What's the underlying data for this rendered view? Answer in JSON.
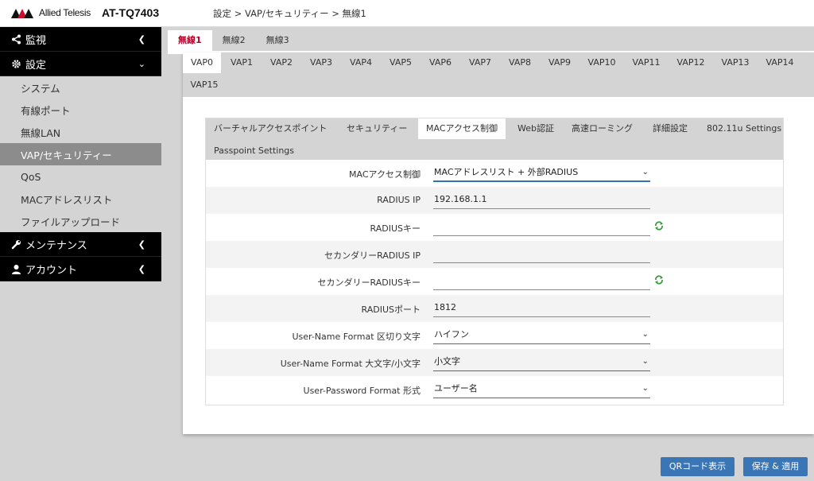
{
  "header": {
    "logo_text": "Allied Telesis",
    "model": "AT-TQ7403",
    "breadcrumb": "設定 > VAP/セキュリティー > 無線1"
  },
  "sidebar": {
    "monitor": "監視",
    "settings": "設定",
    "items": [
      "システム",
      "有線ポート",
      "無線LAN",
      "VAP/セキュリティー",
      "QoS",
      "MACアドレスリスト",
      "ファイルアップロード"
    ],
    "maintenance": "メンテナンス",
    "account": "アカウント"
  },
  "radio_tabs": [
    "無線1",
    "無線2",
    "無線3"
  ],
  "vap_tabs": [
    "VAP0",
    "VAP1",
    "VAP2",
    "VAP3",
    "VAP4",
    "VAP5",
    "VAP6",
    "VAP7",
    "VAP8",
    "VAP9",
    "VAP10",
    "VAP11",
    "VAP12",
    "VAP13",
    "VAP14",
    "VAP15"
  ],
  "sec_tabs": [
    "バーチャルアクセスポイント",
    "セキュリティー",
    "MACアクセス制御",
    "Web認証",
    "高速ローミング",
    "詳細設定",
    "802.11u Settings",
    "Passpoint Settings"
  ],
  "form": {
    "mac_access_label": "MACアクセス制御",
    "mac_access_value": "MACアドレスリスト + 外部RADIUS",
    "radius_ip_label": "RADIUS IP",
    "radius_ip_value": "192.168.1.1",
    "radius_key_label": "RADIUSキー",
    "radius_key_value": "",
    "secondary_ip_label": "セカンダリーRADIUS IP",
    "secondary_ip_value": "",
    "secondary_key_label": "セカンダリーRADIUSキー",
    "secondary_key_value": "",
    "radius_port_label": "RADIUSポート",
    "radius_port_value": "1812",
    "delimiter_label": "User-Name Format 区切り文字",
    "delimiter_value": "ハイフン",
    "case_label": "User-Name Format 大文字/小文字",
    "case_value": "小文字",
    "password_format_label": "User-Password Format 形式",
    "password_format_value": "ユーザー名"
  },
  "buttons": {
    "qr": "QRコード表示",
    "save": "保存 & 適用"
  },
  "colors": {
    "accent": "#3a76b5",
    "active_radio_tab": "#b0002a",
    "sidebar_active": "#8c8c8c",
    "nav_head_bg": "#000000",
    "generate_icon": "#3a9b3a"
  }
}
